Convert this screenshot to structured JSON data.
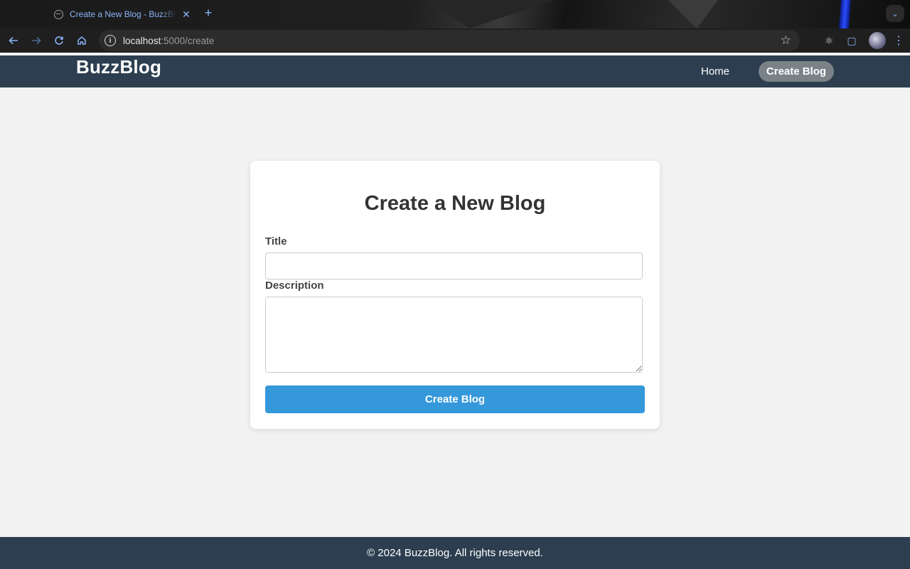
{
  "browser": {
    "tab_title": "Create a New Blog - BuzzBlog",
    "url_host": "localhost",
    "url_path": ":5000/create"
  },
  "site": {
    "logo": "BuzzBlog",
    "nav": {
      "home_label": "Home",
      "create_label": "Create Blog"
    }
  },
  "form": {
    "heading": "Create a New Blog",
    "title_label": "Title",
    "title_value": "",
    "description_label": "Description",
    "description_value": "",
    "submit_label": "Create Blog"
  },
  "footer": {
    "text": "© 2024 BuzzBlog. All rights reserved."
  },
  "colors": {
    "header_bg": "#2c3e50",
    "primary_button": "#3498db",
    "active_nav_pill": "#7a8288",
    "page_bg": "#f2f2f2"
  }
}
